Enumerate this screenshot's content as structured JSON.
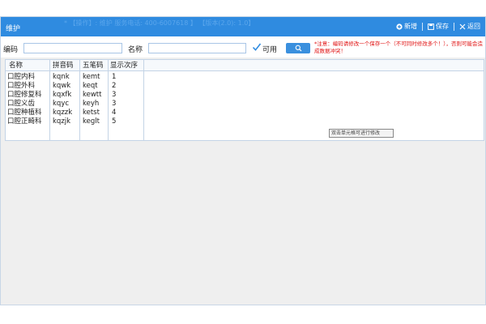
{
  "window": {
    "title": "维护",
    "faint_header": "*  【操作】: 维护  服务电话: 400-6007618  】   【版本(2.0): 1.0】",
    "actions": [
      {
        "label": "新增",
        "icon": "plus-circle-icon"
      },
      {
        "label": "保存",
        "icon": "save-icon"
      },
      {
        "label": "返回",
        "icon": "close-icon"
      }
    ]
  },
  "search": {
    "code_label": "编码",
    "code_value": "",
    "name_label": "名称",
    "name_value": "",
    "enabled_label": "可用",
    "enabled_checked": true,
    "search_icon": "search-icon",
    "notice": "*注意：编码请修改一个保存一个（不可同时修改多个！），否则可能会造成数据冲突！"
  },
  "table": {
    "headers": [
      "名称",
      "拼音码",
      "五笔码",
      "显示次序"
    ],
    "rows": [
      {
        "name": "口腔内科",
        "pinyin": "kqnk",
        "wubi": "kemt",
        "order": "1"
      },
      {
        "name": "口腔外科",
        "pinyin": "kqwk",
        "wubi": "keqt",
        "order": "2"
      },
      {
        "name": "口腔修复科",
        "pinyin": "kqxfk",
        "wubi": "kewtt",
        "order": "3"
      },
      {
        "name": "口腔义齿",
        "pinyin": "kqyc",
        "wubi": "keyh",
        "order": "3"
      },
      {
        "name": "口腔种植科",
        "pinyin": "kqzzk",
        "wubi": "ketst",
        "order": "4"
      },
      {
        "name": "口腔正畸科",
        "pinyin": "kqzjk",
        "wubi": "keglt",
        "order": "5"
      }
    ],
    "tooltip": "双击单元格可进行修改"
  },
  "colors": {
    "titlebar": "#2f8be0",
    "accent": "#3a90de",
    "notice": "#e01010"
  }
}
